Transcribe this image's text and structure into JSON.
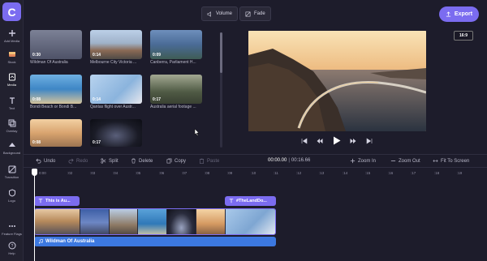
{
  "logo_letter": "C",
  "rail": [
    {
      "label": "Add Media",
      "icon": "plus-icon"
    },
    {
      "label": "Stock",
      "icon": "stock-icon"
    },
    {
      "label": "Media",
      "icon": "media-icon"
    },
    {
      "label": "Text",
      "icon": "text-icon"
    },
    {
      "label": "Overlay",
      "icon": "overlay-icon"
    },
    {
      "label": "Background",
      "icon": "background-icon"
    },
    {
      "label": "Transition",
      "icon": "transition-icon"
    },
    {
      "label": "Logo",
      "icon": "logo-icon"
    },
    {
      "label": "Feature Flags",
      "icon": "more-icon"
    },
    {
      "label": "Help",
      "icon": "help-icon"
    }
  ],
  "media": [
    {
      "duration": "0:30",
      "title": "Wildman Of Australia",
      "color": "#6a6f86"
    },
    {
      "duration": "0:14",
      "title": "Melbourne City Victoria ...",
      "color": "#9aa9c2"
    },
    {
      "duration": "0:09",
      "title": "Canberra, Parliament H...",
      "color": "#4a6b96"
    },
    {
      "duration": "0:08",
      "title": "Bondi Beach or Bondi B...",
      "color": "#3e86c5"
    },
    {
      "duration": "0:14",
      "title": "Qantas flight over Austr...",
      "color": "#8bb4dd"
    },
    {
      "duration": "0:17",
      "title": "Australia aerial footage ...",
      "color": "#4f5a44"
    },
    {
      "duration": "0:08",
      "title": "",
      "color": "#d9a46f"
    },
    {
      "duration": "0:17",
      "title": "",
      "color": "#111219"
    }
  ],
  "toolbar": {
    "volume": "Volume",
    "fade": "Fade",
    "export": "Export",
    "ratio": "16:9"
  },
  "edit": {
    "undo": "Undo",
    "redo": "Redo",
    "split": "Split",
    "delete": "Delete",
    "copy": "Copy",
    "paste": "Paste",
    "current_time": "00:00.00",
    "separator": "|",
    "total_time": "00:16.66",
    "zoom_in": "Zoom In",
    "zoom_out": "Zoom Out",
    "fit": "Fit To Screen"
  },
  "ruler_ticks": [
    "0:00",
    ":02",
    ":03",
    ":04",
    ":05",
    ":06",
    ":07",
    ":08",
    ":09",
    ":10",
    ":11",
    ":12",
    ":13",
    ":14",
    ":15",
    ":16",
    ":17",
    ":18",
    ":19"
  ],
  "tracks": {
    "caption1": "This is Au...",
    "caption2": "#TheLandDo...",
    "audio": "Wildman Of Australia"
  }
}
